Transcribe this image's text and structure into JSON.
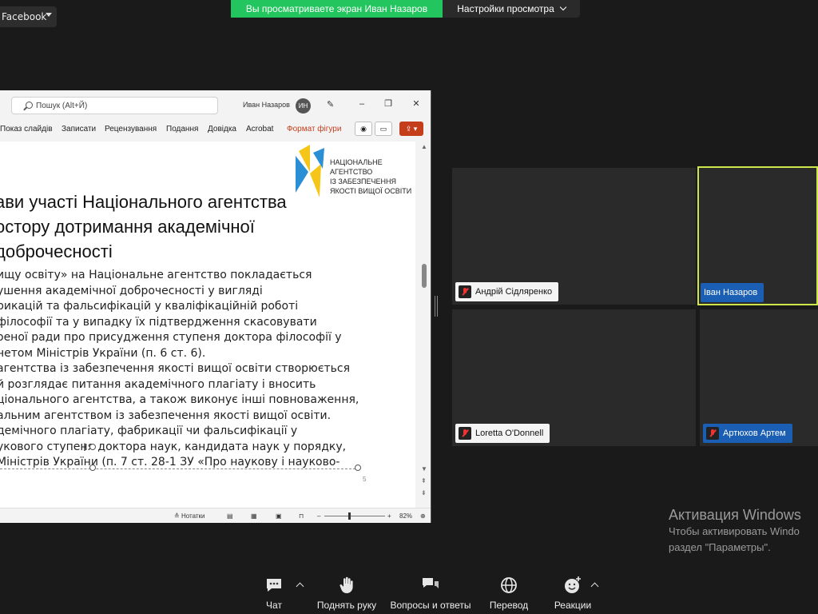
{
  "top": {
    "dropdown_label": "Facebook",
    "share_banner": "Вы просматриваете экран Иван Назаров",
    "view_options": "Настройки просмотра"
  },
  "shared_screen": {
    "search_placeholder": "Пошук (Alt+Й)",
    "user_name": "Иван Назаров",
    "user_initials": "ИН",
    "ribbon_tabs": [
      "Показ слайдів",
      "Записати",
      "Рецензування",
      "Подання",
      "Довідка",
      "Acrobat",
      "Формат фігури"
    ],
    "logo_text": "НАЦІОНАЛЬНЕ\nАГЕНТСТВО\nІЗ ЗАБЕЗПЕЧЕННЯ\nЯКОСТІ ВИЩОЇ ОСВІТИ",
    "heading_lines": [
      "ави участі Національного агентства",
      "остору дотримання академічної",
      " доброчесності"
    ],
    "body_lines": [
      "ищу освіту» на Національне агентство покладається",
      "ушення академічної доброчесності у вигляді",
      "рикацій та фальсифікацій у кваліфікаційній роботі",
      " філософії та у випадку їх підтвердження скасовувати",
      "оеної ради про присудження ступеня доктора філософії у",
      "нетом Міністрів України (п. 6 ст. 6).",
      "агентства із забезпечення якості вищої освіти створюється",
      "й розглядає питання академічного плагіату і вносить",
      "ціонального агентства, а також виконує інші повноваження,",
      "альним агентством із забезпечення якості вищої освіти.",
      "демічного плагіату, фабрикації чи фальсифікації у",
      "укового ступеня доктора наук, кандидата наук у порядку,",
      " Міністрів України (п. 7 ст. 28-1 ЗУ «Про наукову і науково-"
    ],
    "page_number": "5",
    "status_notes": "Нотатки",
    "zoom": "82%"
  },
  "participants": [
    {
      "name": "Андрій Сідляренко",
      "muted": true,
      "tag_style": "white"
    },
    {
      "name": "Іван Назаров",
      "muted": false,
      "tag_style": "blue",
      "active_speaker": true
    },
    {
      "name": "Loretta O'Donnell",
      "muted": true,
      "tag_style": "white"
    },
    {
      "name": "Артюхов Артем",
      "muted": true,
      "tag_style": "blue"
    }
  ],
  "activation": {
    "title": "Активация Windows",
    "line1": "Чтобы активировать Windo",
    "line2": "раздел \"Параметры\"."
  },
  "toolbar": {
    "chat": "Чат",
    "raise_hand": "Поднять руку",
    "qa": "Вопросы и ответы",
    "translate": "Перевод",
    "reactions": "Реакции"
  },
  "colors": {
    "share_banner": "#22c55e",
    "active_speaker_border": "#cfe64a",
    "name_tag_blue": "#1a5fb4",
    "ppt_accent": "#c43e1c"
  }
}
